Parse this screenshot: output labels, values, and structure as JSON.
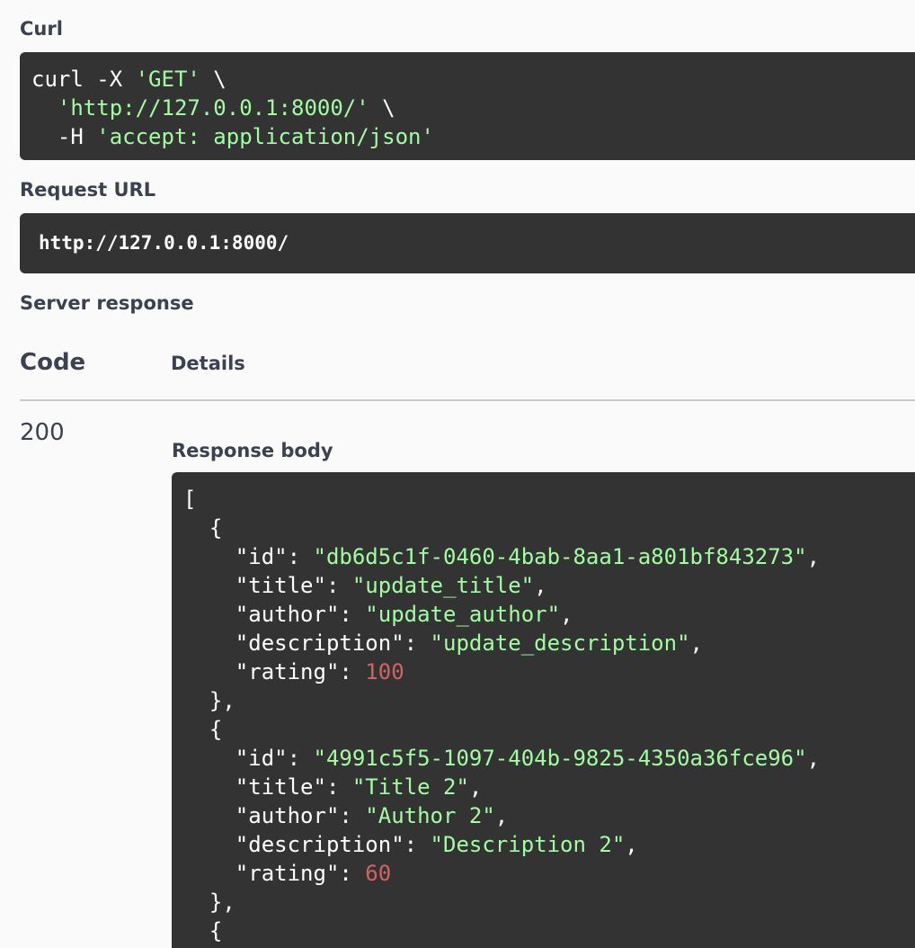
{
  "curl": {
    "label": "Curl",
    "line1_cmd": "curl -X ",
    "line1_method": "'GET'",
    "line1_tail": " \\",
    "line2_indent": "  ",
    "line2_url": "'http://127.0.0.1:8000/'",
    "line2_tail": " \\",
    "line3_flag": "  -H ",
    "line3_header": "'accept: application/json'"
  },
  "request_url": {
    "label": "Request URL",
    "value": "http://127.0.0.1:8000/"
  },
  "server_response": {
    "label": "Server response",
    "col_code": "Code",
    "col_details": "Details",
    "status_code": "200",
    "body_label": "Response body"
  },
  "response_body": {
    "open_array": "[",
    "open_obj": "{",
    "close_obj_comma": "},",
    "items": [
      {
        "id": "\"db6d5c1f-0460-4bab-8aa1-a801bf843273\"",
        "title": "\"update_title\"",
        "author": "\"update_author\"",
        "description": "\"update_description\"",
        "rating": "100"
      },
      {
        "id": "\"4991c5f5-1097-404b-9825-4350a36fce96\"",
        "title": "\"Title 2\"",
        "author": "\"Author 2\"",
        "description": "\"Description 2\"",
        "rating": "60"
      }
    ],
    "keys": {
      "id": "\"id\": ",
      "title": "\"title\": ",
      "author": "\"author\": ",
      "description": "\"description\": ",
      "rating": "\"rating\": "
    }
  },
  "colors": {
    "code_bg": "#333333",
    "string": "#a2fca2",
    "number": "#d36363",
    "text": "#3b4151"
  }
}
